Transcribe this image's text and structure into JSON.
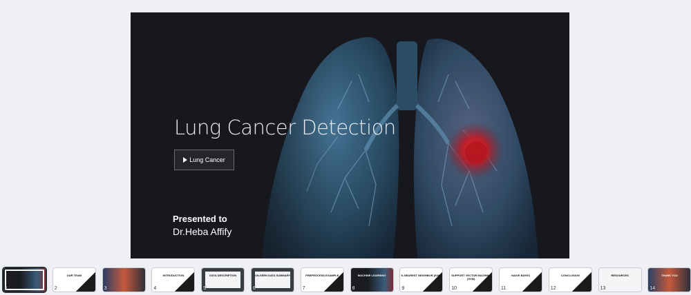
{
  "slide": {
    "title": "Lung Cancer Detection",
    "button_label": "Lung Cancer",
    "presented_to": "Presented to",
    "recipient": "Dr.Heba Affify"
  },
  "thumbnails": [
    {
      "number": "1",
      "theme": "dark",
      "active": true,
      "heading": ""
    },
    {
      "number": "2",
      "theme": "light",
      "active": false,
      "heading": "OUR TEAM"
    },
    {
      "number": "3",
      "theme": "image",
      "active": false,
      "heading": ""
    },
    {
      "number": "4",
      "theme": "light",
      "active": false,
      "heading": "INTRODUCTION"
    },
    {
      "number": "5",
      "theme": "grey",
      "active": false,
      "heading": "DATA DESCRIPTION"
    },
    {
      "number": "6",
      "theme": "grey",
      "active": false,
      "heading": "UN-SEEN DATA SUMMARY"
    },
    {
      "number": "7",
      "theme": "light",
      "active": false,
      "heading": "PREPROCESS EXAMPLE"
    },
    {
      "number": "8",
      "theme": "dark",
      "active": false,
      "heading": "MACHINE LEARNING"
    },
    {
      "number": "9",
      "theme": "light",
      "active": false,
      "heading": "K-NEAREST NEIGHBOR (KNN)"
    },
    {
      "number": "10",
      "theme": "light",
      "active": false,
      "heading": "SUPPORT VECTOR MACHINE (SVM)"
    },
    {
      "number": "11",
      "theme": "light",
      "active": false,
      "heading": "NAIVE BAYES"
    },
    {
      "number": "12",
      "theme": "light",
      "active": false,
      "heading": "CONCLUSION"
    },
    {
      "number": "13",
      "theme": "white",
      "active": false,
      "heading": "RESOURCES"
    },
    {
      "number": "14",
      "theme": "image",
      "active": false,
      "heading": "THANK YOU"
    }
  ],
  "colors": {
    "slide_bg": "#17181d",
    "lung_blue": "#3d6f95",
    "tumor_red": "#d0202a",
    "app_bg": "#eef0f4"
  }
}
